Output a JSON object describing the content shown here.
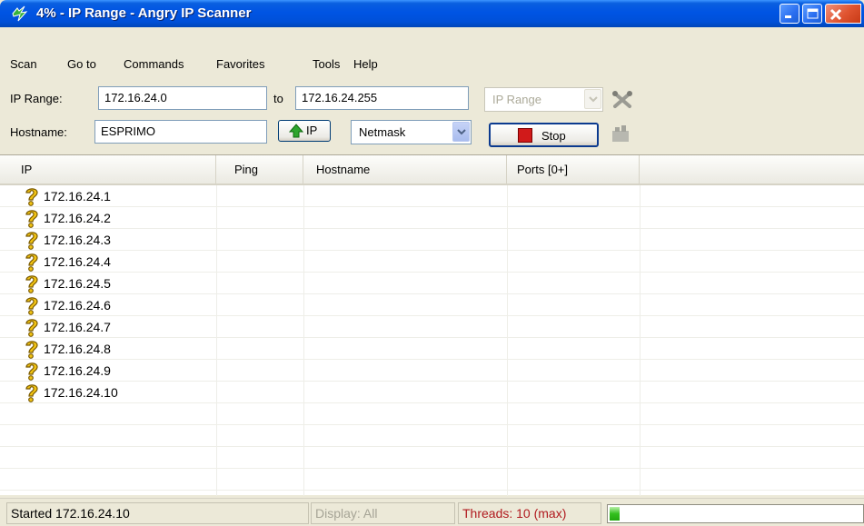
{
  "window": {
    "title": "4% - IP Range - Angry IP Scanner"
  },
  "menu": {
    "items": [
      "Scan",
      "Go to",
      "Commands",
      "Favorites",
      "Tools",
      "Help"
    ]
  },
  "toolbar": {
    "ip_range_label": "IP Range:",
    "ip_start": "172.16.24.0",
    "to_label": "to",
    "ip_end": "172.16.24.255",
    "feeder_select": "IP Range",
    "hostname_label": "Hostname:",
    "hostname": "ESPRIMO",
    "ip_button_label": "IP",
    "netmask_select": "Netmask",
    "stop_button_label": "Stop"
  },
  "table": {
    "columns": [
      "IP",
      "Ping",
      "Hostname",
      "Ports [0+]"
    ],
    "rows": [
      {
        "ip": "172.16.24.1",
        "icon": "unknown-question-icon"
      },
      {
        "ip": "172.16.24.2",
        "icon": "unknown-question-icon"
      },
      {
        "ip": "172.16.24.3",
        "icon": "unknown-question-icon"
      },
      {
        "ip": "172.16.24.4",
        "icon": "unknown-question-icon"
      },
      {
        "ip": "172.16.24.5",
        "icon": "unknown-question-icon"
      },
      {
        "ip": "172.16.24.6",
        "icon": "unknown-question-icon"
      },
      {
        "ip": "172.16.24.7",
        "icon": "unknown-question-icon"
      },
      {
        "ip": "172.16.24.8",
        "icon": "unknown-question-icon"
      },
      {
        "ip": "172.16.24.9",
        "icon": "unknown-question-icon"
      },
      {
        "ip": "172.16.24.10",
        "icon": "unknown-question-icon"
      }
    ]
  },
  "status": {
    "started": "Started 172.16.24.10",
    "display": "Display: All",
    "threads": "Threads: 10 (max)",
    "progress_percent": 4
  },
  "colors": {
    "titlebar": "#0054e3",
    "threads_text": "#b0191e",
    "progress_fill": "#33c01e",
    "stop_red": "#d11a1a"
  }
}
